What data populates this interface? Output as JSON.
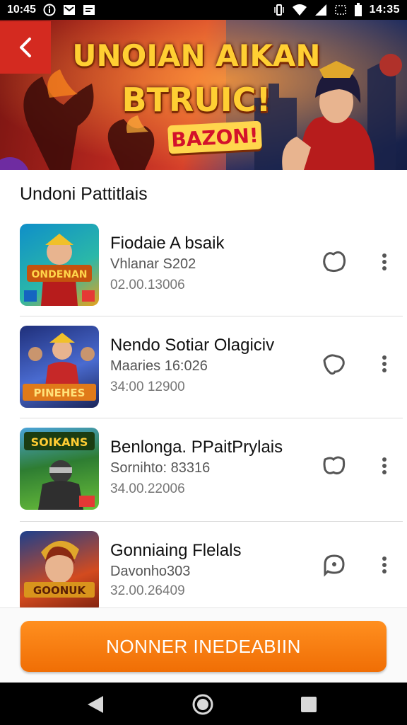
{
  "status_bar": {
    "time_left": "10:45",
    "time_right": "14:35",
    "left_icons": [
      "info-circle-icon",
      "mail-icon",
      "message-icon"
    ],
    "right_icons": [
      "vibrate-icon",
      "wifi-icon",
      "signal-icon",
      "data-icon",
      "battery-icon"
    ]
  },
  "banner": {
    "title_line1": "UNOIAN AIKAN",
    "title_line2": "BTRUIC!",
    "badge": "BAZON!"
  },
  "section": {
    "title": "Undoni Pattitlais"
  },
  "games": [
    {
      "name": "Fiodaie A bsaik",
      "sub": "Vhlanar S202",
      "date": "02.00.13006",
      "thumb_label": "ONDENAN",
      "thumb_colors": [
        "#0f8fc9",
        "#2bb8a8"
      ]
    },
    {
      "name": "Nendo Sotiar Olagiciv",
      "sub": "Maaries 16:026",
      "date": "34:00 12900",
      "thumb_label": "PINEHES",
      "thumb_colors": [
        "#1f2f7a",
        "#4a6bd0"
      ]
    },
    {
      "name": "Benlonga. PPaitPrylais",
      "sub": "Sornihto: 83316",
      "date": "34.00.22006",
      "thumb_label": "SOIKANS",
      "thumb_colors": [
        "#2e7d32",
        "#6abf3a"
      ]
    },
    {
      "name": "Gonniaing Flelals",
      "sub": "Davonho303",
      "date": "32.00.26409",
      "thumb_label": "GOONUK",
      "thumb_colors": [
        "#1c3f8c",
        "#d34b1f"
      ]
    }
  ],
  "cta": {
    "label": "NONNER INEDEABIIN",
    "color": "#f47a0c"
  },
  "nav": {
    "icons": [
      "back-triangle-icon",
      "home-circle-icon",
      "recents-square-icon"
    ]
  },
  "colors": {
    "accent": "#f47a0c",
    "banner_red": "#d42a20"
  }
}
